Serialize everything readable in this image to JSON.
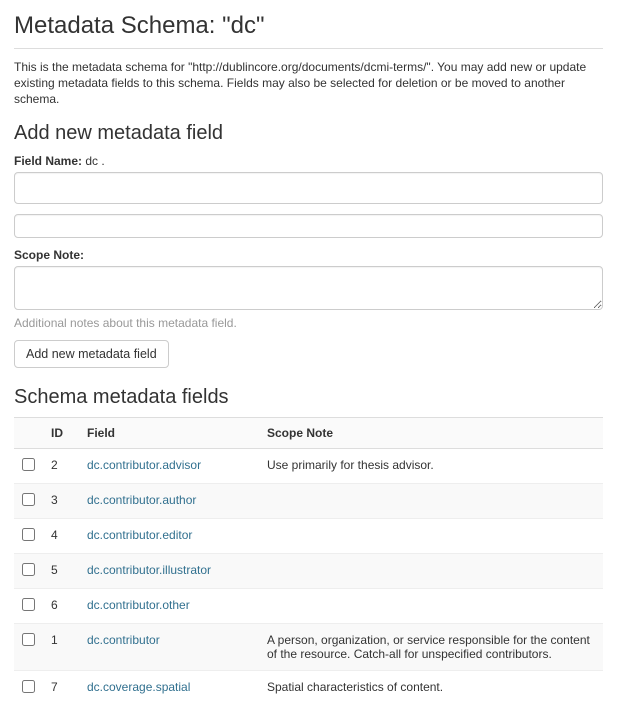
{
  "page": {
    "title": "Metadata Schema: \"dc\"",
    "intro": "This is the metadata schema for \"http://dublincore.org/documents/dcmi-terms/\". You may add new or update existing metadata fields to this schema. Fields may also be selected for deletion or be moved to another schema."
  },
  "addForm": {
    "heading": "Add new metadata field",
    "fieldNameLabel": "Field Name:",
    "fieldNamePrefix": " dc .",
    "scopeNoteLabel": "Scope Note:",
    "helpText": "Additional notes about this metadata field.",
    "buttonLabel": "Add new metadata field"
  },
  "listing": {
    "heading": "Schema metadata fields",
    "columns": {
      "id": "ID",
      "field": "Field",
      "scope": "Scope Note"
    },
    "rows": [
      {
        "id": "2",
        "field": "dc.contributor.advisor",
        "scope": "Use primarily for thesis advisor."
      },
      {
        "id": "3",
        "field": "dc.contributor.author",
        "scope": ""
      },
      {
        "id": "4",
        "field": "dc.contributor.editor",
        "scope": ""
      },
      {
        "id": "5",
        "field": "dc.contributor.illustrator",
        "scope": ""
      },
      {
        "id": "6",
        "field": "dc.contributor.other",
        "scope": ""
      },
      {
        "id": "1",
        "field": "dc.contributor",
        "scope": "A person, organization, or service responsible for the content of the resource. Catch-all for unspecified contributors."
      },
      {
        "id": "7",
        "field": "dc.coverage.spatial",
        "scope": "Spatial characteristics of content."
      }
    ]
  }
}
